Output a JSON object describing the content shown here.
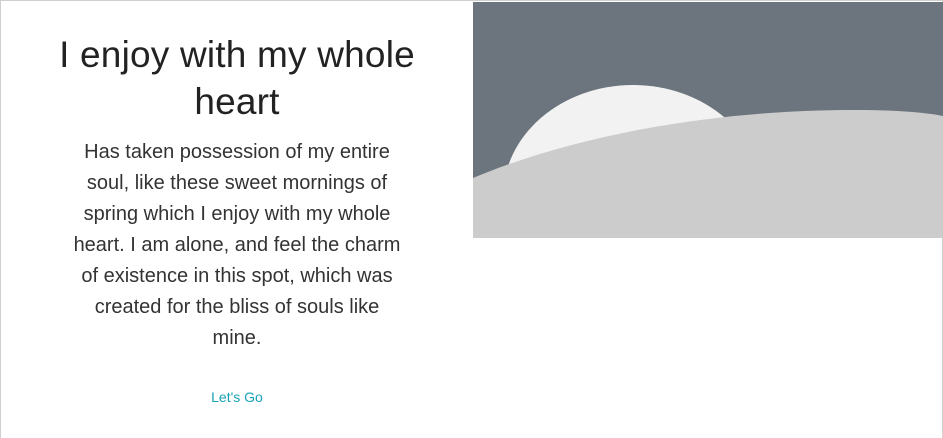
{
  "hero": {
    "title": "I enjoy with my whole heart",
    "body": "Has taken possession of my entire soul, like these sweet mornings of spring which I enjoy with my whole heart. I am alone, and feel the charm of existence in this spot, which was created for the bliss of souls like mine.",
    "cta_label": "Let's Go"
  },
  "image": {
    "description_icon": "placeholder-landscape-image",
    "sky_color": "#6c757d",
    "sun_color": "#f2f2f2",
    "hill_color": "#cccccc"
  },
  "colors": {
    "link": "#17a2b8",
    "title_text": "#222222",
    "body_text": "#333333"
  }
}
